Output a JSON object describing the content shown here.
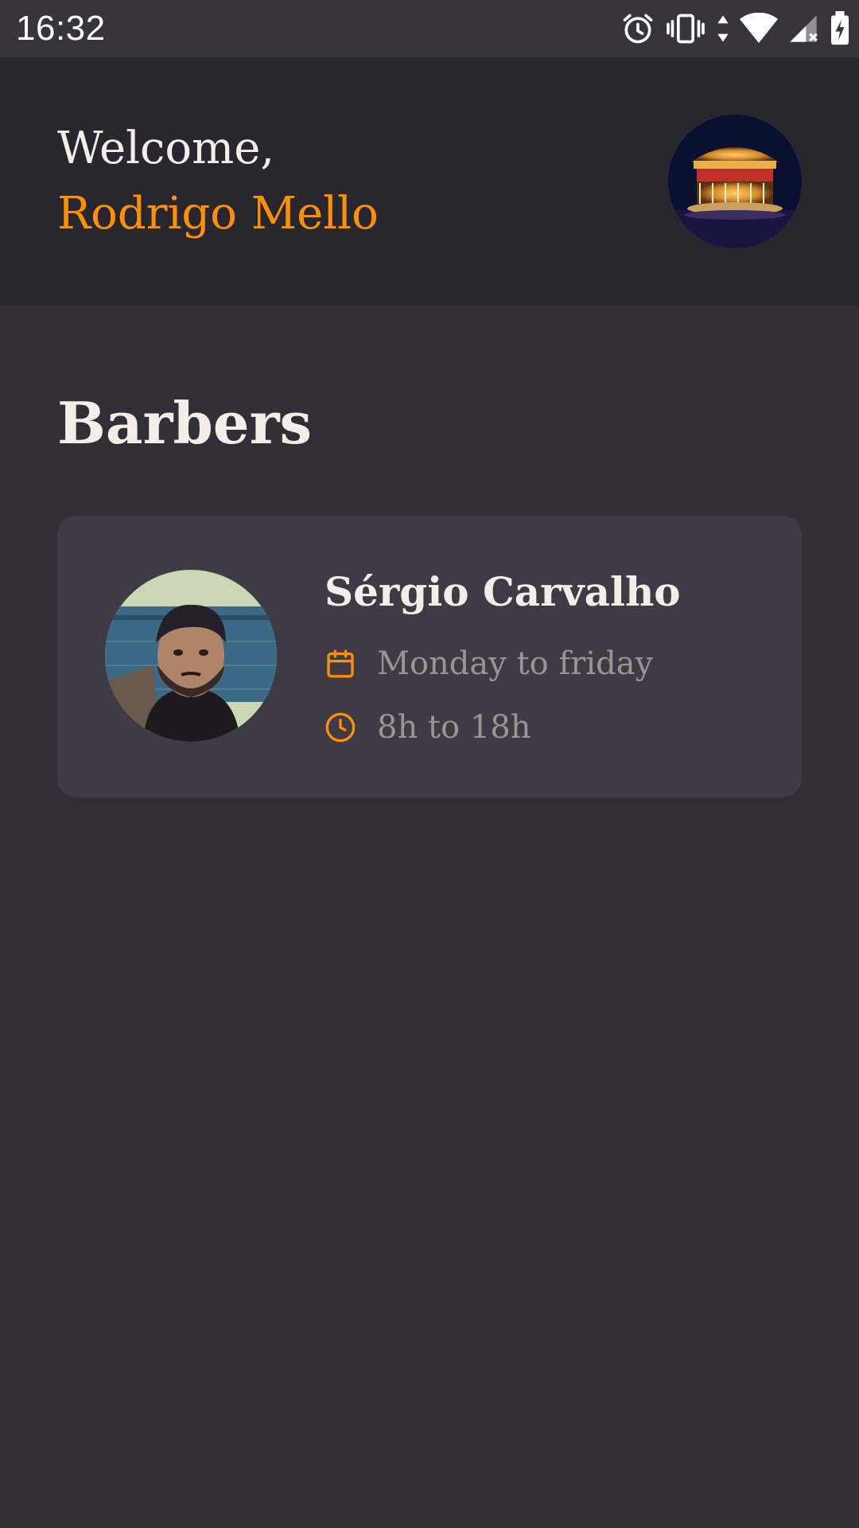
{
  "status_bar": {
    "time": "16:32",
    "icons": [
      "alarm-icon",
      "vibrate-icon",
      "data-arrows-icon",
      "wifi-icon",
      "cell-signal-icon",
      "battery-charging-icon"
    ]
  },
  "header": {
    "welcome_label": "Welcome,",
    "user_name": "Rodrigo Mello",
    "avatar": "profile-avatar"
  },
  "main": {
    "section_title": "Barbers",
    "barbers": [
      {
        "name": "Sérgio Carvalho",
        "days": "Monday to friday",
        "hours": "8h to 18h",
        "days_icon": "calendar-icon",
        "hours_icon": "clock-icon"
      }
    ]
  },
  "colors": {
    "background": "#312e38",
    "header": "#28262e",
    "card": "#3e3b47",
    "accent": "#ff9000",
    "text": "#f4ede8",
    "muted_text": "#999591"
  }
}
